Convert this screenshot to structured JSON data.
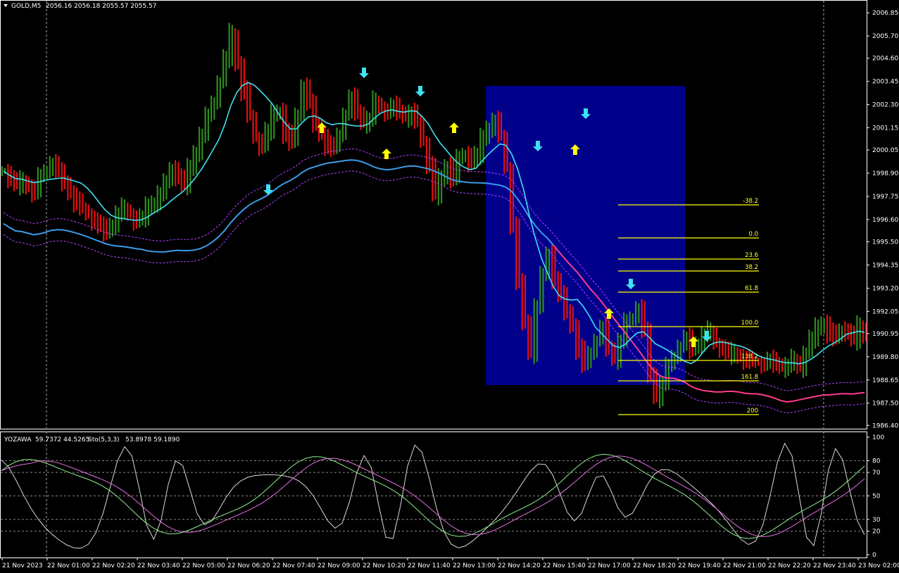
{
  "header": {
    "symbol": "GOLD,M5",
    "prices": "2056.16 2056.18 2055.57 2055.57"
  },
  "indicator_header": {
    "name": "YOZAWA",
    "values": "59.7372 44.5265",
    "sto_name": "Sto(5,3,3)",
    "sto_values": "53.8978 59.1890"
  },
  "colors": {
    "bull_bar": "#2e8b1e",
    "bear_bar": "#e01010",
    "fast_ma": "#40e0f0",
    "slow_ma": "#3a9be8",
    "slow_ma_down": "#ff3d8a",
    "envelope": "#b040ff",
    "fib": "#ffff00",
    "box": "#00008b",
    "up_arrow": "#ffff00",
    "down_arrow": "#40e0f0",
    "stoch_main": "#90ee90",
    "stoch_signal": "#e070e0",
    "yozawa": "#d8d8d8"
  },
  "chart_data": [
    {
      "type": "line",
      "title": "GOLD,M5",
      "price_axis_ticks": [
        "2006.85",
        "2005.70",
        "2004.60",
        "2003.45",
        "2002.30",
        "2001.15",
        "2000.05",
        "1998.90",
        "1997.75",
        "1996.60",
        "1995.50",
        "1994.35",
        "1993.20",
        "1992.05",
        "1990.95",
        "1989.80",
        "1988.65",
        "1987.50",
        "1986.40"
      ],
      "ylim": [
        1986.2,
        2007.1
      ],
      "time_axis_ticks": [
        "21 Nov 2023",
        "22 Nov 01:00",
        "22 Nov 02:20",
        "22 Nov 03:40",
        "22 Nov 05:00",
        "22 Nov 06:20",
        "22 Nov 07:40",
        "22 Nov 09:00",
        "22 Nov 10:20",
        "22 Nov 11:40",
        "22 Nov 13:00",
        "22 Nov 14:20",
        "22 Nov 15:40",
        "22 Nov 17:00",
        "22 Nov 18:20",
        "22 Nov 19:40",
        "22 Nov 21:00",
        "22 Nov 22:20",
        "22 Nov 23:40",
        "23 Nov 02:00"
      ],
      "close_series": [
        1999.0,
        1998.6,
        1998.3,
        1998.5,
        1998.2,
        1998.0,
        1998.7,
        1999.1,
        1999.4,
        1998.9,
        1998.5,
        1997.9,
        1997.5,
        1997.2,
        1996.8,
        1996.5,
        1996.2,
        1996.0,
        1996.4,
        1996.9,
        1997.2,
        1996.8,
        1996.5,
        1996.7,
        1997.2,
        1997.5,
        1997.9,
        1998.4,
        1999.2,
        1998.7,
        1998.3,
        1999.1,
        2000.0,
        2000.8,
        2001.7,
        2002.5,
        2003.4,
        2004.6,
        2005.8,
        2004.3,
        2003.0,
        2001.8,
        2000.6,
        2000.2,
        2001.0,
        2001.8,
        2002.0,
        2000.9,
        2000.4,
        2001.9,
        2003.2,
        2002.3,
        2001.4,
        2000.8,
        2000.3,
        2000.1,
        2000.9,
        2001.8,
        2002.6,
        2002.0,
        2001.4,
        2001.6,
        2002.5,
        2002.1,
        2001.9,
        2002.2,
        2002.0,
        2001.7,
        2001.9,
        2001.5,
        2000.4,
        1999.3,
        1997.8,
        1998.6,
        1999.3,
        1998.7,
        1999.6,
        1999.9,
        1999.4,
        1999.8,
        2000.6,
        2001.2,
        2001.5,
        2000.8,
        1999.1,
        1996.3,
        1993.4,
        1991.6,
        1990.0,
        1992.3,
        1993.8,
        1995.0,
        1993.6,
        1992.8,
        1992.1,
        1991.3,
        1990.2,
        1989.4,
        1990.1,
        1990.6,
        1991.2,
        1990.3,
        1989.7,
        1990.6,
        1991.5,
        1991.8,
        1992.2,
        1991.0,
        1989.0,
        1987.8,
        1988.5,
        1989.3,
        1989.9,
        1990.3,
        1990.7,
        1990.2,
        1990.5,
        1990.9,
        1991.1,
        1990.4,
        1990.2,
        1989.9,
        1990.0,
        1989.8,
        1989.7,
        1989.6,
        1989.5,
        1989.4,
        1989.6,
        1989.5,
        1989.3,
        1989.4,
        1989.7,
        1989.2,
        1990.0,
        1990.7,
        1991.2,
        1991.5,
        1991.0,
        1990.7,
        1991.2,
        1991.0,
        1990.6,
        1991.3,
        1990.8
      ]
    },
    {
      "type": "line",
      "title": "YOZAWA / Sto(5,3,3)",
      "ylim": [
        0,
        100
      ],
      "axis_ticks": [
        "100",
        "80",
        "70",
        "50",
        "30",
        "20",
        "0"
      ]
    }
  ],
  "fibonacci": {
    "levels": [
      "-38.2",
      "0.0",
      "23.6",
      "38.2",
      "61.8",
      "100.0",
      "138.2",
      "161.8",
      "200"
    ]
  }
}
